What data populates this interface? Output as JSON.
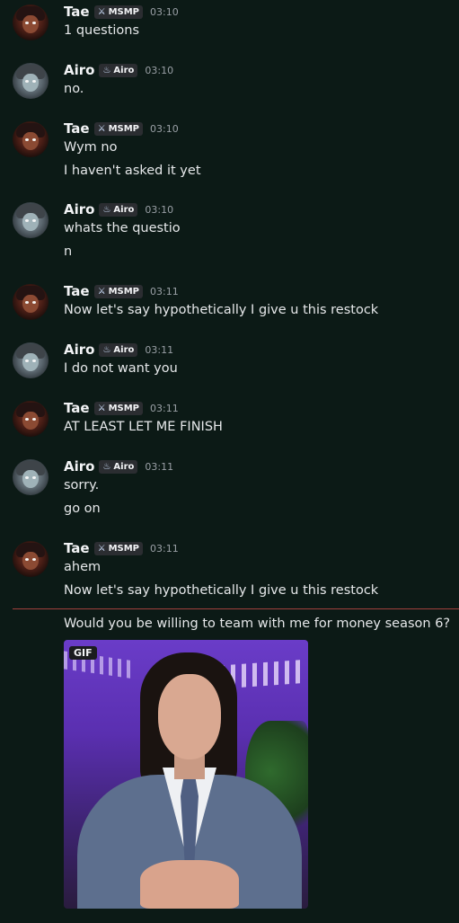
{
  "messages": [
    {
      "user": "Tae",
      "avatar": "tae",
      "tag_icon": "sword-icon",
      "tag": "MSMP",
      "time": "03:10",
      "lines": [
        "1 questions"
      ]
    },
    {
      "user": "Airo",
      "avatar": "airo",
      "tag_icon": "flame-icon",
      "tag": "Airo",
      "time": "03:10",
      "lines": [
        "no."
      ]
    },
    {
      "user": "Tae",
      "avatar": "tae",
      "tag_icon": "sword-icon",
      "tag": "MSMP",
      "time": "03:10",
      "lines": [
        "Wym no",
        "I haven't asked it yet"
      ]
    },
    {
      "user": "Airo",
      "avatar": "airo",
      "tag_icon": "flame-icon",
      "tag": "Airo",
      "time": "03:10",
      "lines": [
        "whats the questio",
        "n"
      ]
    },
    {
      "user": "Tae",
      "avatar": "tae",
      "tag_icon": "sword-icon",
      "tag": "MSMP",
      "time": "03:11",
      "lines": [
        "Now let's say hypothetically I give u this restock"
      ]
    },
    {
      "user": "Airo",
      "avatar": "airo",
      "tag_icon": "flame-icon",
      "tag": "Airo",
      "time": "03:11",
      "lines": [
        "I do not want you"
      ]
    },
    {
      "user": "Tae",
      "avatar": "tae",
      "tag_icon": "sword-icon",
      "tag": "MSMP",
      "time": "03:11",
      "lines": [
        "AT LEAST LET ME FINISH"
      ]
    },
    {
      "user": "Airo",
      "avatar": "airo",
      "tag_icon": "flame-icon",
      "tag": "Airo",
      "time": "03:11",
      "lines": [
        "sorry.",
        "go on"
      ]
    },
    {
      "user": "Tae",
      "avatar": "tae",
      "tag_icon": "sword-icon",
      "tag": "MSMP",
      "time": "03:11",
      "lines": [
        "ahem",
        "Now let's say hypothetically I give u this restock"
      ]
    }
  ],
  "new_message": "Would you be willing to team with me for money season 6?",
  "gif_label": "GIF",
  "colors": {
    "background": "#0c1a16",
    "divider": "#a0403c",
    "tag_bg": "#2b2d31"
  }
}
